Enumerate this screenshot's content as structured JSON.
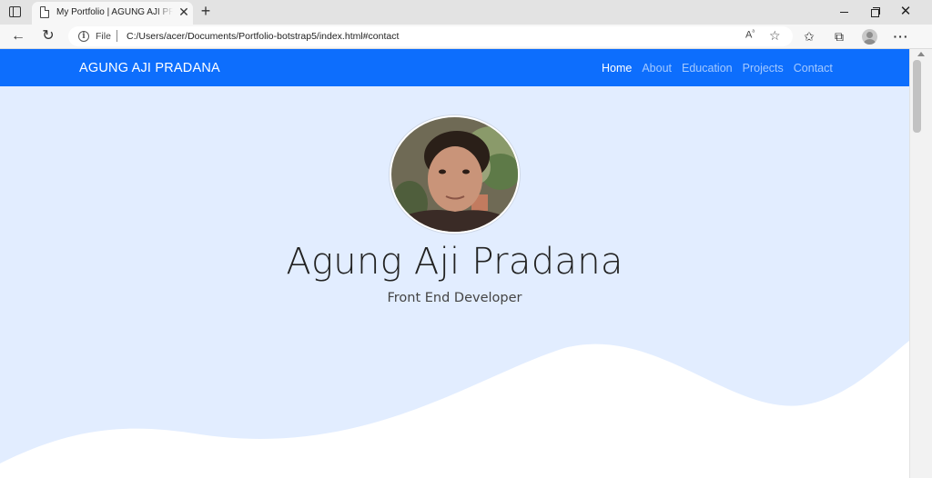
{
  "browser": {
    "tab_title": "My Portfolio | AGUNG AJI PRADANA",
    "tab_close": "✕",
    "new_tab": "+",
    "address_scheme": "File",
    "address_url": "C:/Users/acer/Documents/Portfolio-botstrap5/index.html#contact",
    "icons": {
      "back": "arrow-left-icon",
      "reload": "reload-icon",
      "info": "info-icon",
      "read_aloud": "read-aloud-icon",
      "add_favorite": "add-favorite-icon",
      "favorites": "favorites-icon",
      "collections": "collections-icon",
      "profile": "profile-icon",
      "more": "more-icon"
    }
  },
  "site": {
    "brand": "AGUNG AJI PRADANA",
    "nav": {
      "items": [
        {
          "label": "Home",
          "active": true
        },
        {
          "label": "About",
          "active": false
        },
        {
          "label": "Education",
          "active": false
        },
        {
          "label": "Projects",
          "active": false
        },
        {
          "label": "Contact",
          "active": false
        }
      ]
    },
    "hero": {
      "name": "Agung Aji Pradana",
      "role": "Front End Developer"
    }
  },
  "colors": {
    "navbar": "#0d6efd",
    "hero_background": "#e2edff",
    "wave": "#ffffff"
  }
}
